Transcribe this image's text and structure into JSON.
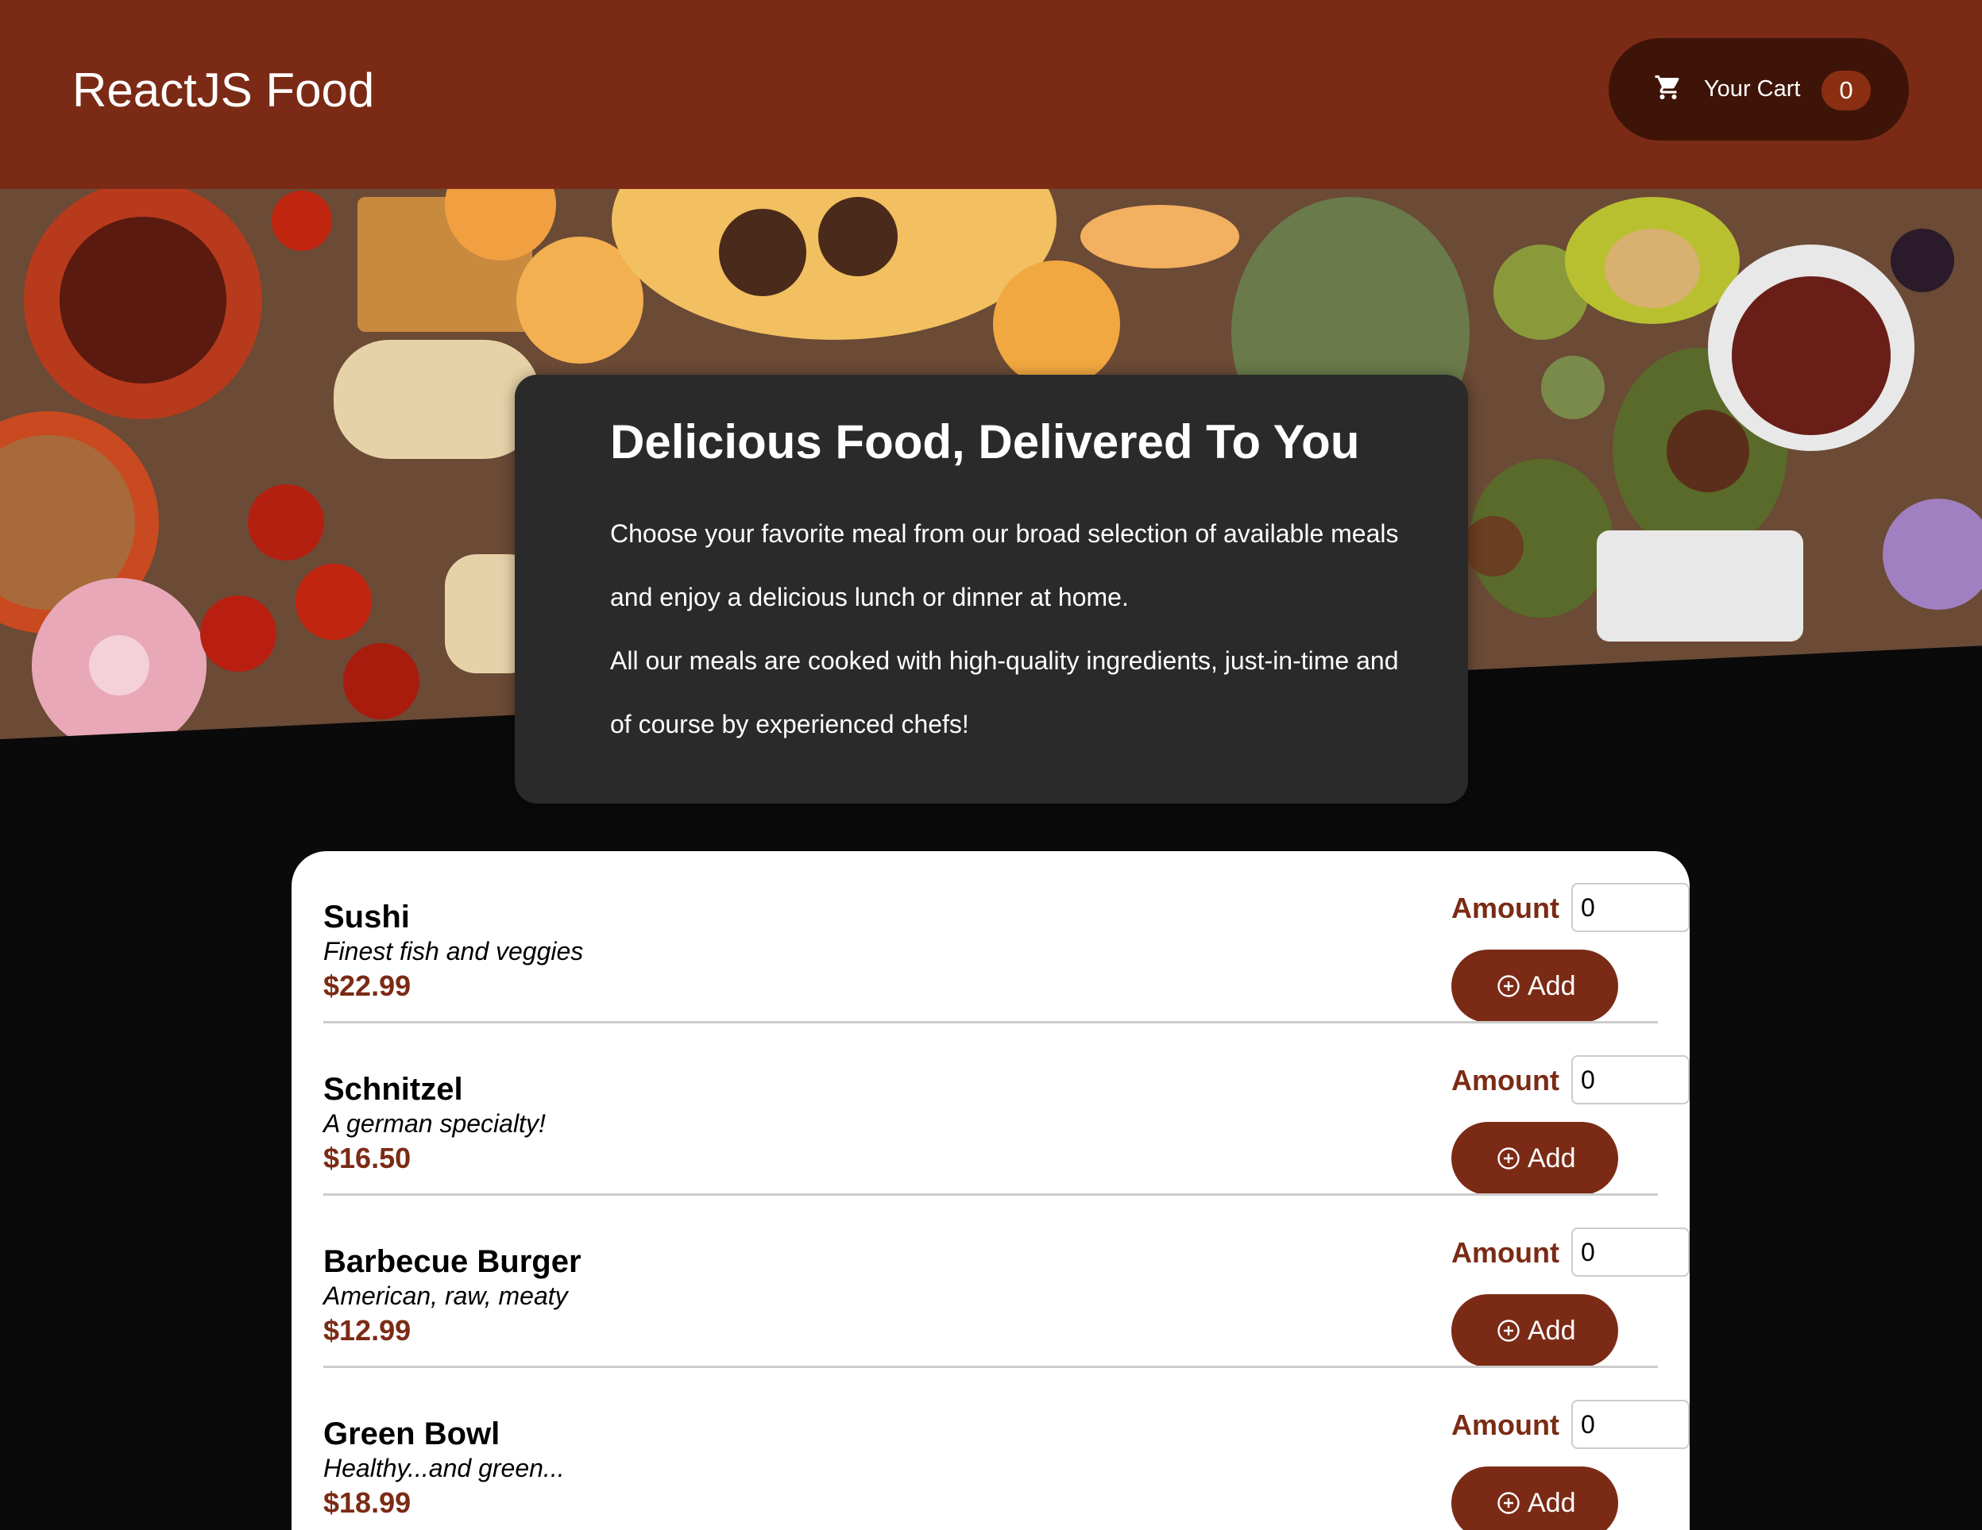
{
  "header": {
    "title": "ReactJS Food",
    "cart": {
      "label": "Your Cart",
      "count": "0",
      "icon": "cart-icon"
    }
  },
  "summary": {
    "title": "Delicious Food, Delivered To You",
    "paragraphs": [
      "Choose your favorite meal from our broad selection of available meals and enjoy a delicious lunch or dinner at home.",
      "All our meals are cooked with high-quality ingredients, just-in-time and of course by experienced chefs!"
    ]
  },
  "meals": {
    "amount_label": "Amount",
    "add_label": "Add",
    "add_icon": "plus-circle-icon",
    "items": [
      {
        "name": "Sushi",
        "description": "Finest fish and veggies",
        "price": "$22.99",
        "amount": "0"
      },
      {
        "name": "Schnitzel",
        "description": "A german specialty!",
        "price": "$16.50",
        "amount": "0"
      },
      {
        "name": "Barbecue Burger",
        "description": "American, raw, meaty",
        "price": "$12.99",
        "amount": "0"
      },
      {
        "name": "Green Bowl",
        "description": "Healthy...and green...",
        "price": "$18.99",
        "amount": "0"
      }
    ]
  },
  "colors": {
    "brand": "#7b2b15",
    "cart_bg": "#3f1408",
    "summary_bg": "#2a2a2a",
    "page_bg": "#0a0a0a"
  }
}
